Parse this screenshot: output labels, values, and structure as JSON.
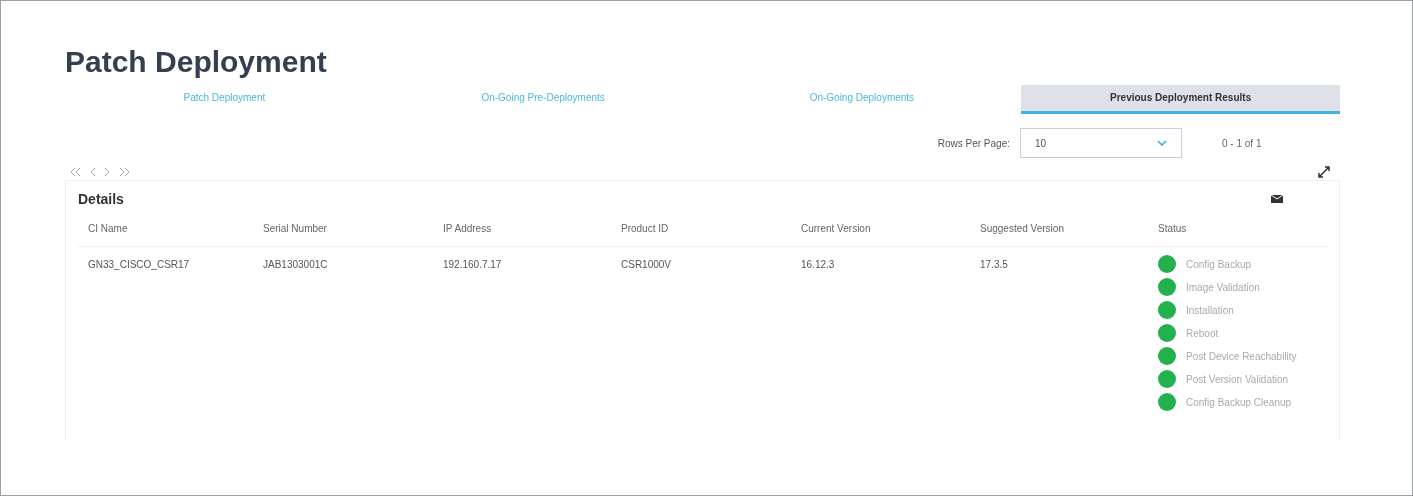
{
  "title": "Patch Deployment",
  "tabs": [
    {
      "label": "Patch Deployment",
      "selected": false
    },
    {
      "label": "On-Going Pre-Deployments",
      "selected": false
    },
    {
      "label": "On-Going Deployments",
      "selected": false
    },
    {
      "label": "Previous Deployment Results",
      "selected": true
    }
  ],
  "pagination": {
    "rows_per_page_label": "Rows Per Page:",
    "rows_per_page": "10",
    "range": "0 - 1 of 1"
  },
  "details": {
    "title": "Details",
    "columns": [
      "CI Name",
      "Serial Number",
      "IP Address",
      "Product ID",
      "Current Version",
      "Suggested Version",
      "Status"
    ],
    "rows": [
      {
        "cells": [
          "GN33_CISCO_CSR17",
          "JAB1303001C",
          "192.160.7.17",
          "CSR1000V",
          "16.12.3",
          "17.3.5"
        ],
        "status_steps": [
          {
            "label": "Config Backup",
            "color": "#22b14c"
          },
          {
            "label": "Image Validation",
            "color": "#22b14c"
          },
          {
            "label": "Installation",
            "color": "#22b14c"
          },
          {
            "label": "Reboot",
            "color": "#22b14c"
          },
          {
            "label": "Post Device Reachability",
            "color": "#22b14c"
          },
          {
            "label": "Post Version Validation",
            "color": "#22b14c"
          },
          {
            "label": "Config Backup Cleanup",
            "color": "#22b14c"
          }
        ]
      }
    ]
  }
}
